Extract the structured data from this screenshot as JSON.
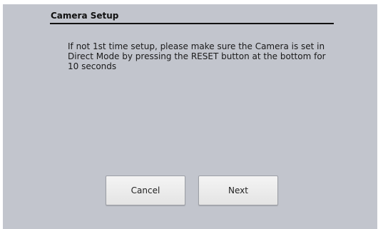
{
  "dialog": {
    "title": "Camera Setup",
    "message": "If not 1st time setup, please make sure the Camera is set in Direct Mode by pressing the RESET button at the bottom for 10 seconds",
    "buttons": {
      "cancel_label": "Cancel",
      "next_label": "Next"
    }
  },
  "colors": {
    "dialog_background": "#c2c5cd",
    "text": "#111111",
    "button_background": "#ececec"
  }
}
